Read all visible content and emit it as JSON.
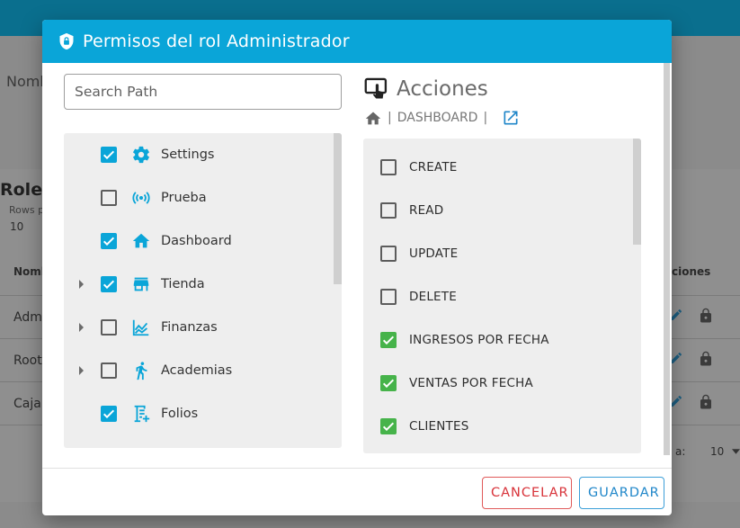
{
  "background": {
    "partial_field_label": "Nomb",
    "section_title": "Roles",
    "rows_label": "Rows p",
    "rows_value": "10",
    "column_name": "Nomb",
    "column_actions": "ciones",
    "rows": [
      "Adm",
      "Root",
      "Caja"
    ],
    "pagination_label": "a:",
    "pagination_value": "10"
  },
  "modal": {
    "title": "Permisos del rol Administrador",
    "search": {
      "placeholder": "Search Path",
      "value": ""
    },
    "tree": [
      {
        "label": "Settings",
        "checked": true,
        "expandable": false,
        "icon": "gear-icon"
      },
      {
        "label": "Prueba",
        "checked": false,
        "expandable": false,
        "icon": "broadcast-icon"
      },
      {
        "label": "Dashboard",
        "checked": true,
        "expandable": false,
        "icon": "home-icon"
      },
      {
        "label": "Tienda",
        "checked": true,
        "expandable": true,
        "icon": "store-icon"
      },
      {
        "label": "Finanzas",
        "checked": false,
        "expandable": true,
        "icon": "chart-icon"
      },
      {
        "label": "Academias",
        "checked": false,
        "expandable": true,
        "icon": "run-icon"
      },
      {
        "label": "Folios",
        "checked": true,
        "expandable": false,
        "icon": "list-add-icon"
      }
    ],
    "actions": {
      "title": "Acciones",
      "breadcrumb": "DASHBOARD",
      "items": [
        {
          "label": "CREATE",
          "checked": false
        },
        {
          "label": "READ",
          "checked": false
        },
        {
          "label": "UPDATE",
          "checked": false
        },
        {
          "label": "DELETE",
          "checked": false
        },
        {
          "label": "INGRESOS POR FECHA",
          "checked": true
        },
        {
          "label": "VENTAS POR FECHA",
          "checked": true
        },
        {
          "label": "CLIENTES",
          "checked": true
        }
      ]
    },
    "buttons": {
      "cancel": "CANCELAR",
      "save": "GUARDAR"
    }
  },
  "colors": {
    "header": "#0aa5d8",
    "tree_checkbox": "#0aa5d8",
    "action_checkbox": "#46b34a",
    "cancel": "#d8333a",
    "save": "#1f86c9"
  }
}
